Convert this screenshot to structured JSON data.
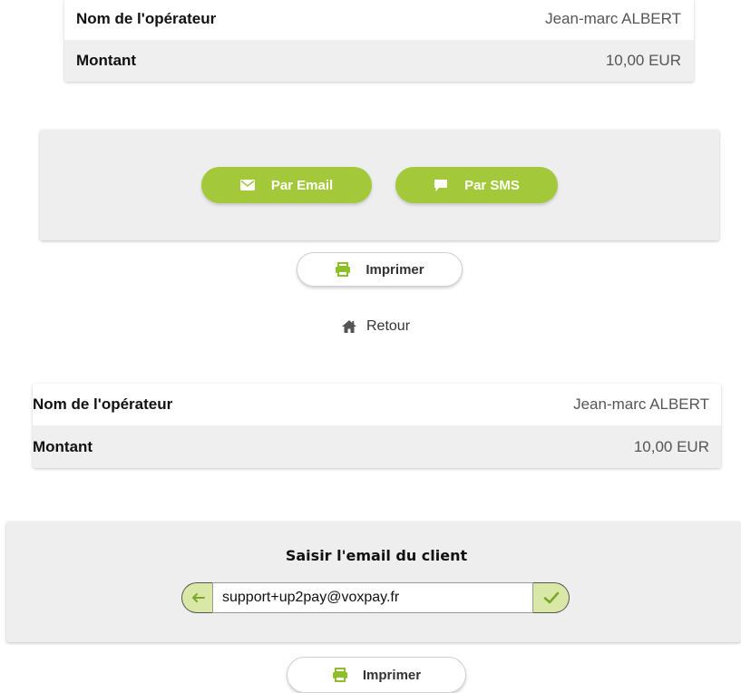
{
  "top_section": {
    "operator_label": "Nom de l'opérateur",
    "operator_value": "Jean-marc ALBERT",
    "amount_label": "Montant",
    "amount_value": "10,00 EUR",
    "send_email_label": "Par Email",
    "send_sms_label": "Par SMS",
    "print_label": "Imprimer",
    "back_label": "Retour"
  },
  "bottom_section": {
    "operator_label": "Nom de l'opérateur",
    "operator_value": "Jean-marc ALBERT",
    "amount_label": "Montant",
    "amount_value": "10,00 EUR",
    "email_prompt_title": "Saisir l'email du client",
    "email_value": "support+up2pay@voxpay.fr",
    "print_label": "Imprimer"
  },
  "colors": {
    "accent_green": "#a3c93a",
    "light_green": "#d9e8a7",
    "panel_grey": "#eeeeee"
  },
  "icons": [
    "envelope-icon",
    "speech-bubble-icon",
    "printer-icon",
    "home-icon",
    "arrow-left-icon",
    "checkmark-icon"
  ]
}
